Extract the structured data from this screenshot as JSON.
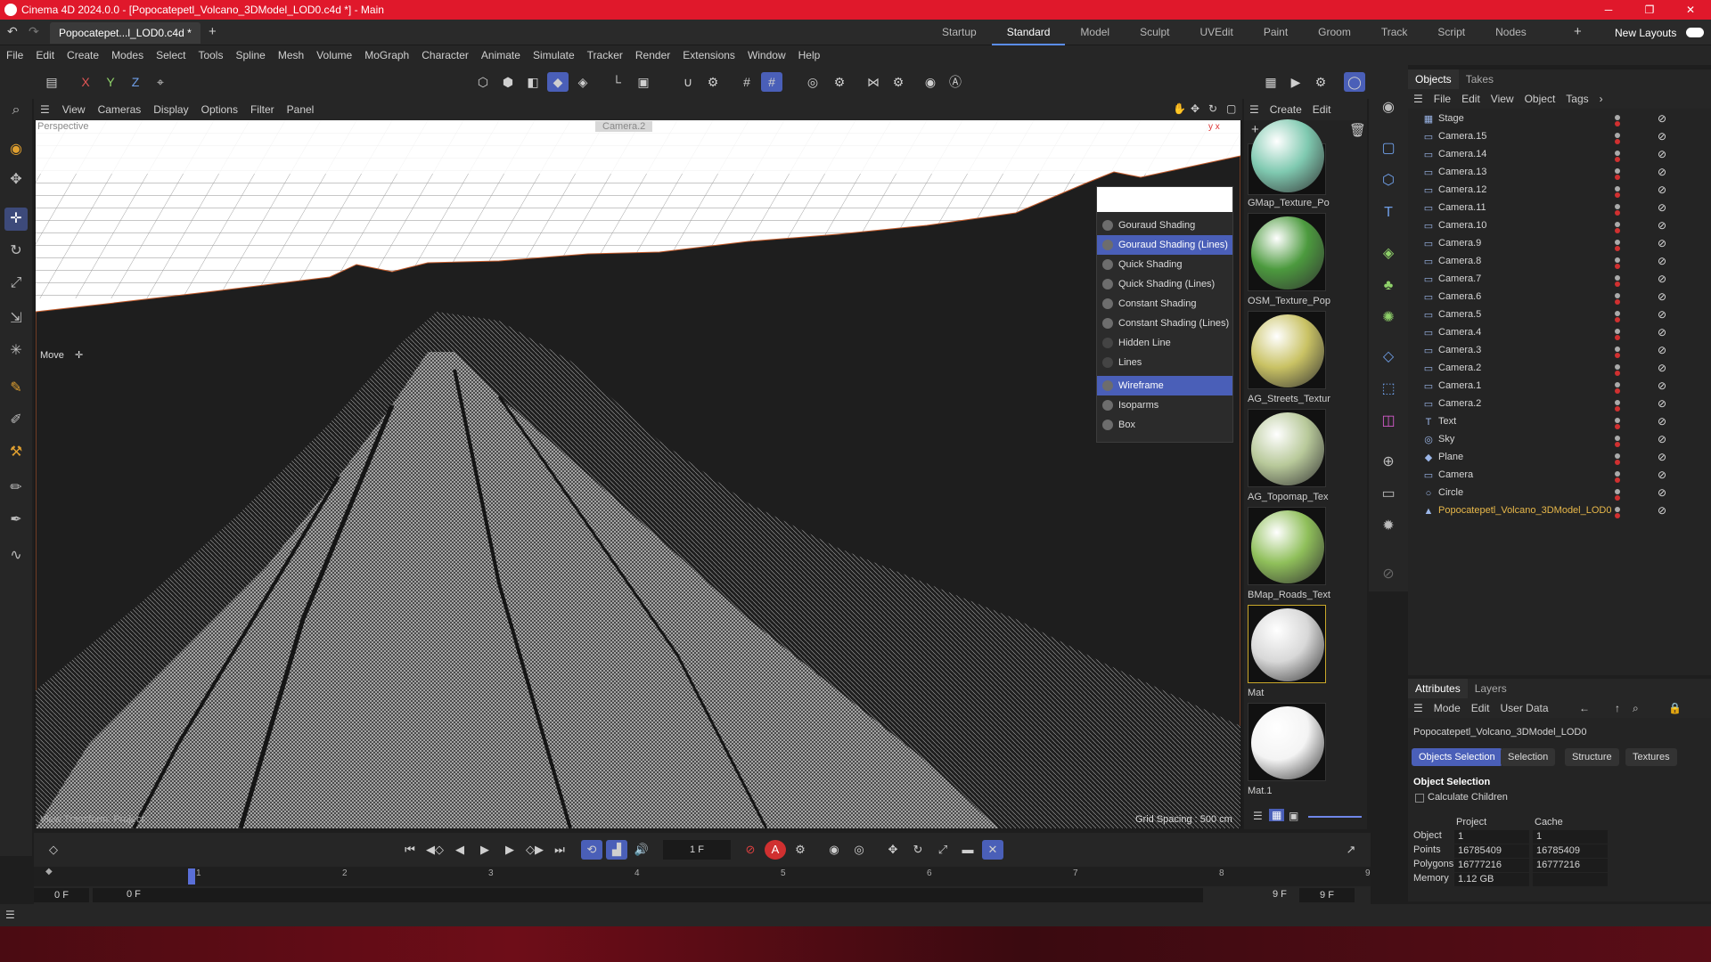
{
  "window": {
    "title": "Cinema 4D 2024.0.0 - [Popocatepetl_Volcano_3DModel_LOD0.c4d *] - Main",
    "doc_tab": "Popocatepet...l_LOD0.c4d *",
    "layouts": [
      "Startup",
      "Standard",
      "Model",
      "Sculpt",
      "UVEdit",
      "Paint",
      "Groom",
      "Track",
      "Script",
      "Nodes"
    ],
    "new_layouts": "New Layouts"
  },
  "menubar": [
    "File",
    "Edit",
    "Create",
    "Modes",
    "Select",
    "Tools",
    "Spline",
    "Mesh",
    "Volume",
    "MoGraph",
    "Character",
    "Animate",
    "Simulate",
    "Tracker",
    "Render",
    "Extensions",
    "Window",
    "Help"
  ],
  "viewport": {
    "menu": [
      "View",
      "Cameras",
      "Display",
      "Options",
      "Filter",
      "Panel"
    ],
    "view_label": "Perspective",
    "camera_label": "Camera.2",
    "move_label": "Move",
    "bottom_left": "View Transform: Project",
    "grid_spacing": "Grid Spacing : 500 cm"
  },
  "shading_menu": {
    "items": [
      "Gouraud Shading",
      "Gouraud Shading (Lines)",
      "Quick Shading",
      "Quick Shading (Lines)",
      "Constant Shading",
      "Constant Shading (Lines)",
      "Hidden Line",
      "Lines"
    ],
    "items2": [
      "Wireframe",
      "Isoparms",
      "Box"
    ],
    "highlight_color": "#4a5fb8"
  },
  "materials": {
    "menu": [
      "Create",
      "Edit"
    ],
    "items": [
      {
        "name": "GMap_Texture_Po",
        "color": "#7fc9b0"
      },
      {
        "name": "OSM_Texture_Pop",
        "color": "#4c9a3e"
      },
      {
        "name": "AG_Streets_Textur",
        "color": "#c9c264"
      },
      {
        "name": "AG_Topomap_Tex",
        "color": "#b8c99a"
      },
      {
        "name": "BMap_Roads_Text",
        "color": "#8fbf5a"
      },
      {
        "name": "Mat",
        "color": "#d8d8d8"
      },
      {
        "name": "Mat.1",
        "color": "#f4f4f4"
      }
    ]
  },
  "objects": {
    "tabs": [
      "Objects",
      "Takes"
    ],
    "menu": [
      "File",
      "Edit",
      "View",
      "Object",
      "Tags"
    ],
    "rows": [
      {
        "name": "Stage",
        "icon": "stage-icon"
      },
      {
        "name": "Camera.15",
        "icon": "camera-icon"
      },
      {
        "name": "Camera.14",
        "icon": "camera-icon"
      },
      {
        "name": "Camera.13",
        "icon": "camera-icon"
      },
      {
        "name": "Camera.12",
        "icon": "camera-icon"
      },
      {
        "name": "Camera.11",
        "icon": "camera-icon"
      },
      {
        "name": "Camera.10",
        "icon": "camera-icon"
      },
      {
        "name": "Camera.9",
        "icon": "camera-icon"
      },
      {
        "name": "Camera.8",
        "icon": "camera-icon"
      },
      {
        "name": "Camera.7",
        "icon": "camera-icon"
      },
      {
        "name": "Camera.6",
        "icon": "camera-icon"
      },
      {
        "name": "Camera.5",
        "icon": "camera-icon"
      },
      {
        "name": "Camera.4",
        "icon": "camera-icon"
      },
      {
        "name": "Camera.3",
        "icon": "camera-icon"
      },
      {
        "name": "Camera.2",
        "icon": "camera-icon"
      },
      {
        "name": "Camera.1",
        "icon": "camera-icon"
      },
      {
        "name": "Camera.2",
        "icon": "camera-icon"
      },
      {
        "name": "Text",
        "icon": "text-icon"
      },
      {
        "name": "Sky",
        "icon": "sky-icon"
      },
      {
        "name": "Plane",
        "icon": "plane-icon"
      },
      {
        "name": "Camera",
        "icon": "camera-icon"
      },
      {
        "name": "Circle",
        "icon": "circle-icon"
      },
      {
        "name": "Popocatepetl_Volcano_3DModel_LOD0",
        "icon": "mesh-icon",
        "selected_color": "#e8b84a"
      }
    ]
  },
  "attributes": {
    "tabs": [
      "Attributes",
      "Layers"
    ],
    "menu": [
      "Mode",
      "Edit",
      "User Data"
    ],
    "object_name": "Popocatepetl_Volcano_3DModel_LOD0",
    "subtabs": [
      "Objects Selection",
      "Selection",
      "Structure",
      "Textures"
    ],
    "section": "Object Selection",
    "calc_children": "Calculate Children",
    "col_project": "Project",
    "col_cache": "Cache",
    "rows": [
      {
        "label": "Object",
        "project": "1",
        "cache": "1"
      },
      {
        "label": "Points",
        "project": "16785409",
        "cache": "16785409"
      },
      {
        "label": "Polygons",
        "project": "16777216",
        "cache": "16777216"
      },
      {
        "label": "Memory",
        "project": "1.12 GB",
        "cache": ""
      }
    ]
  },
  "timeline": {
    "current_frame": "1 F",
    "ticks": [
      "1",
      "2",
      "3",
      "4",
      "5",
      "6",
      "7",
      "8",
      "9"
    ],
    "start_a": "0 F",
    "start_b": "0 F",
    "end_a": "9 F",
    "end_b": "9 F"
  }
}
